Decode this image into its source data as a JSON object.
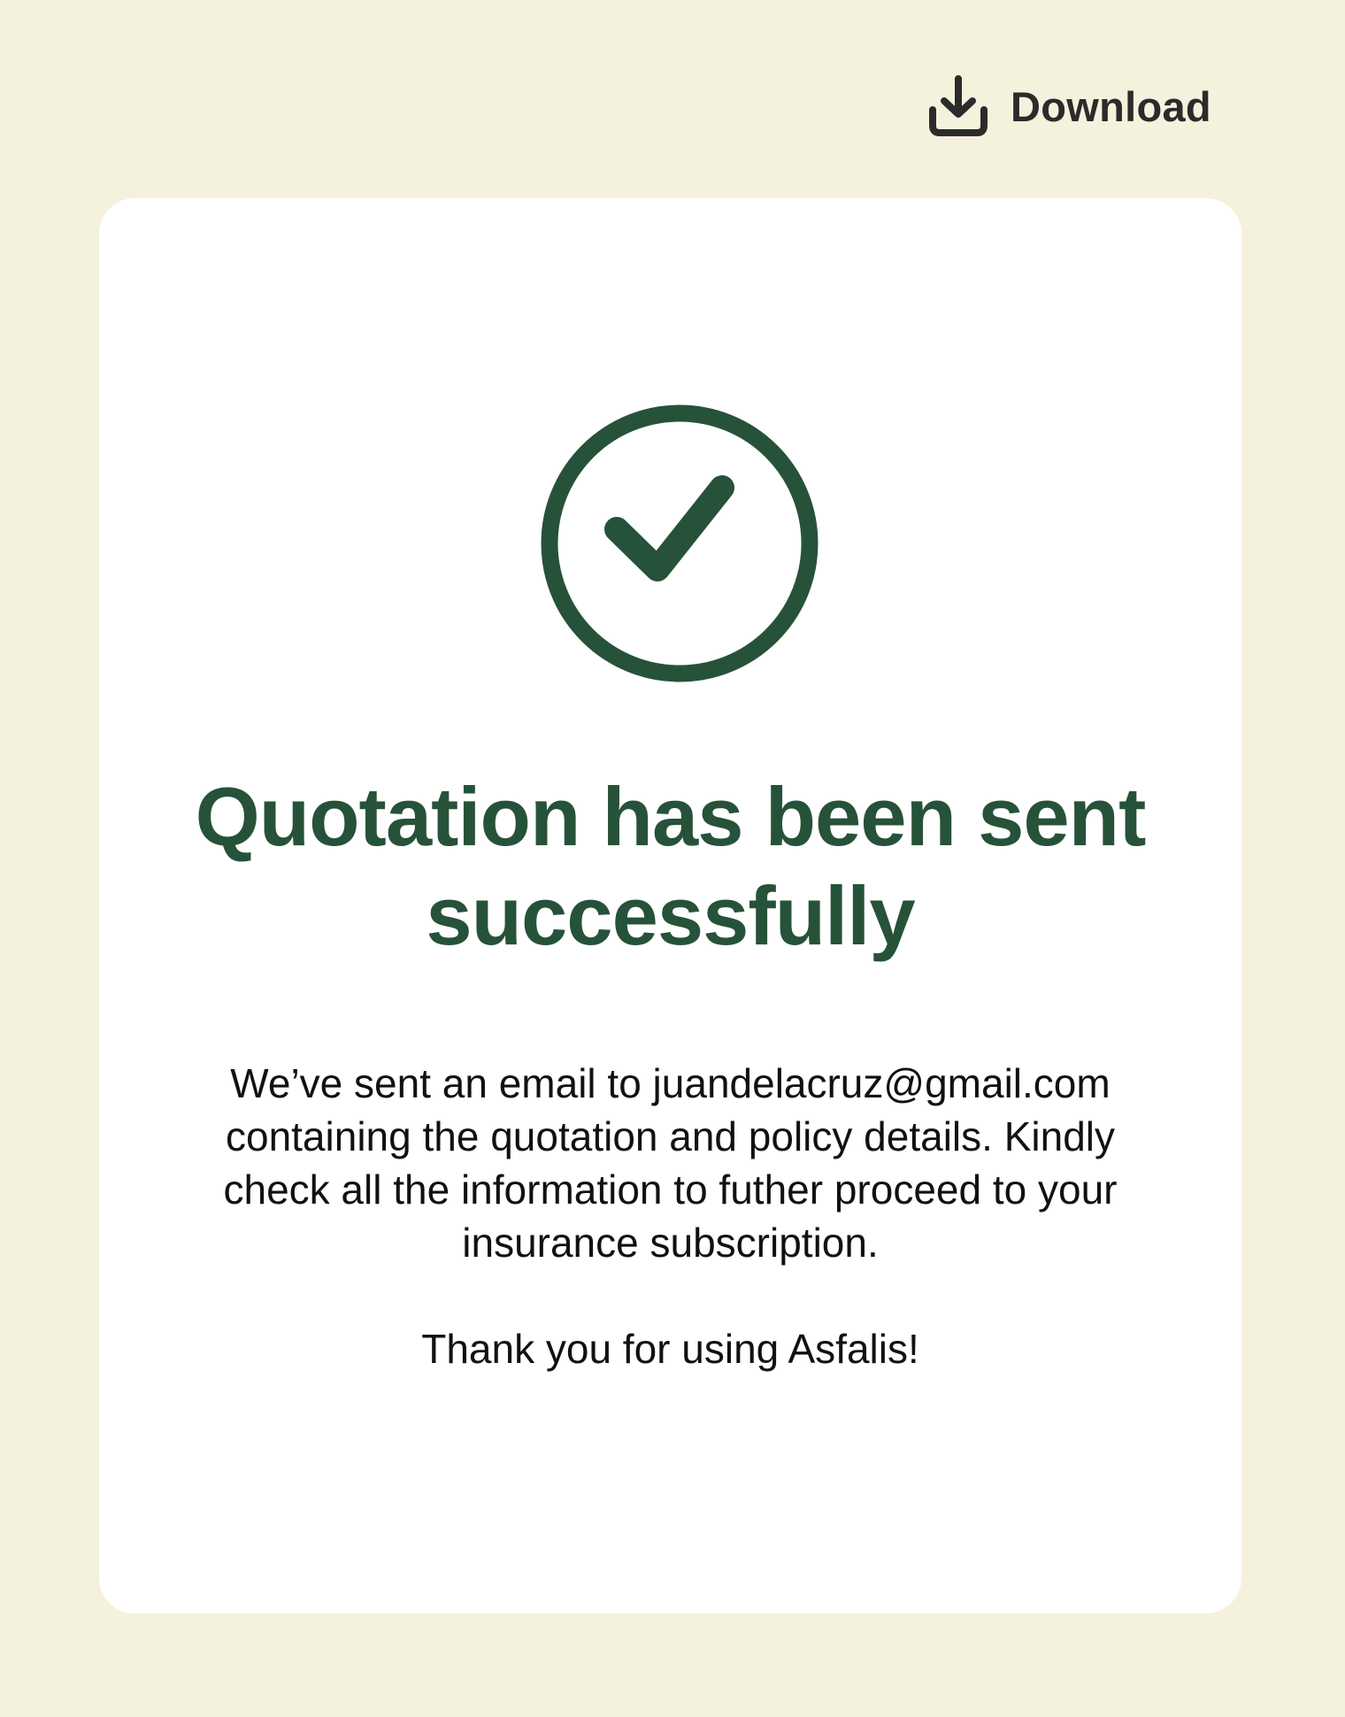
{
  "toolbar": {
    "download_label": "Download",
    "download_icon": "download-icon"
  },
  "confirmation": {
    "status_icon": "check-circle-icon",
    "title": "Quotation has been sent successfully",
    "message": "We’ve sent an email to juandelacruz@gmail.com containing the quotation and policy details. Kindly check all the information to futher proceed to your insurance subscription.",
    "thanks": "Thank you for using Asfalis!"
  },
  "colors": {
    "page_background": "#f4f2dd",
    "card_background": "#ffffff",
    "accent_green": "#265239",
    "download_text": "#2b2b2b",
    "body_text": "#111111"
  }
}
